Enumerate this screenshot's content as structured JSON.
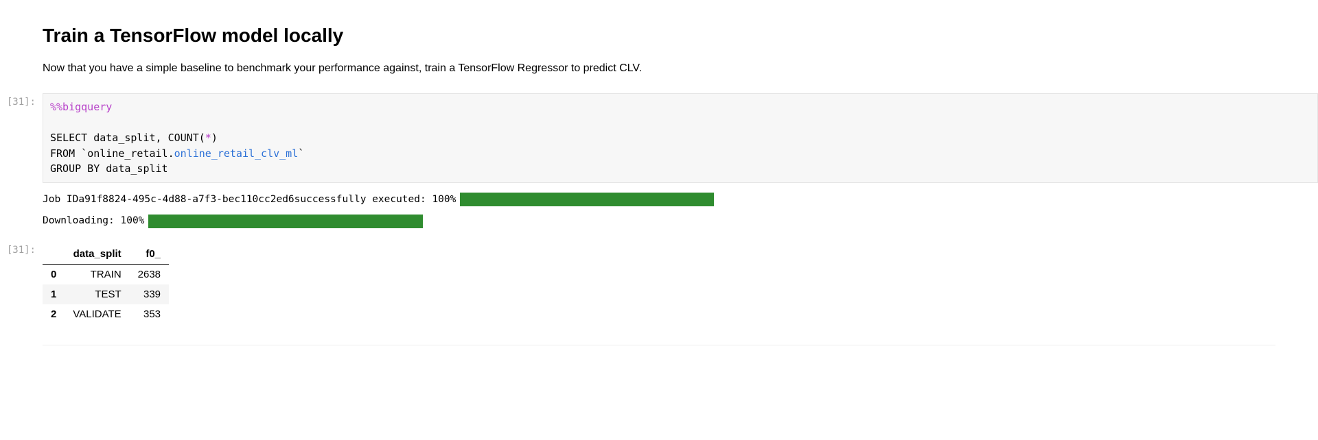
{
  "heading": "Train a TensorFlow model locally",
  "intro": "Now that you have a simple baseline to benchmark your performance against, train a TensorFlow Regressor to predict CLV.",
  "prompt_in": "[31]:",
  "prompt_out": "[31]:",
  "code": {
    "magic": "%%bigquery",
    "kw_select": "SELECT",
    "select_cols": " data_split, COUNT(",
    "star": "*",
    "select_close": ")",
    "kw_from": "FROM",
    "tick_open": " `",
    "schema": "online_retail.",
    "table": "online_retail_clv_ml",
    "tick_close": "`",
    "kw_group": "GROUP BY",
    "group_cols": " data_split"
  },
  "output": {
    "job_line_prefix": "Job ID ",
    "job_id": "a91f8824-495c-4d88-a7f3-bec110cc2ed6",
    "job_line_suffix": " successfully executed: 100%",
    "download_line": "Downloading: 100%"
  },
  "table": {
    "columns": [
      "data_split",
      "f0_"
    ],
    "rows": [
      {
        "idx": "0",
        "data_split": "TRAIN",
        "f0_": "2638"
      },
      {
        "idx": "1",
        "data_split": "TEST",
        "f0_": "339"
      },
      {
        "idx": "2",
        "data_split": "VALIDATE",
        "f0_": "353"
      }
    ]
  }
}
